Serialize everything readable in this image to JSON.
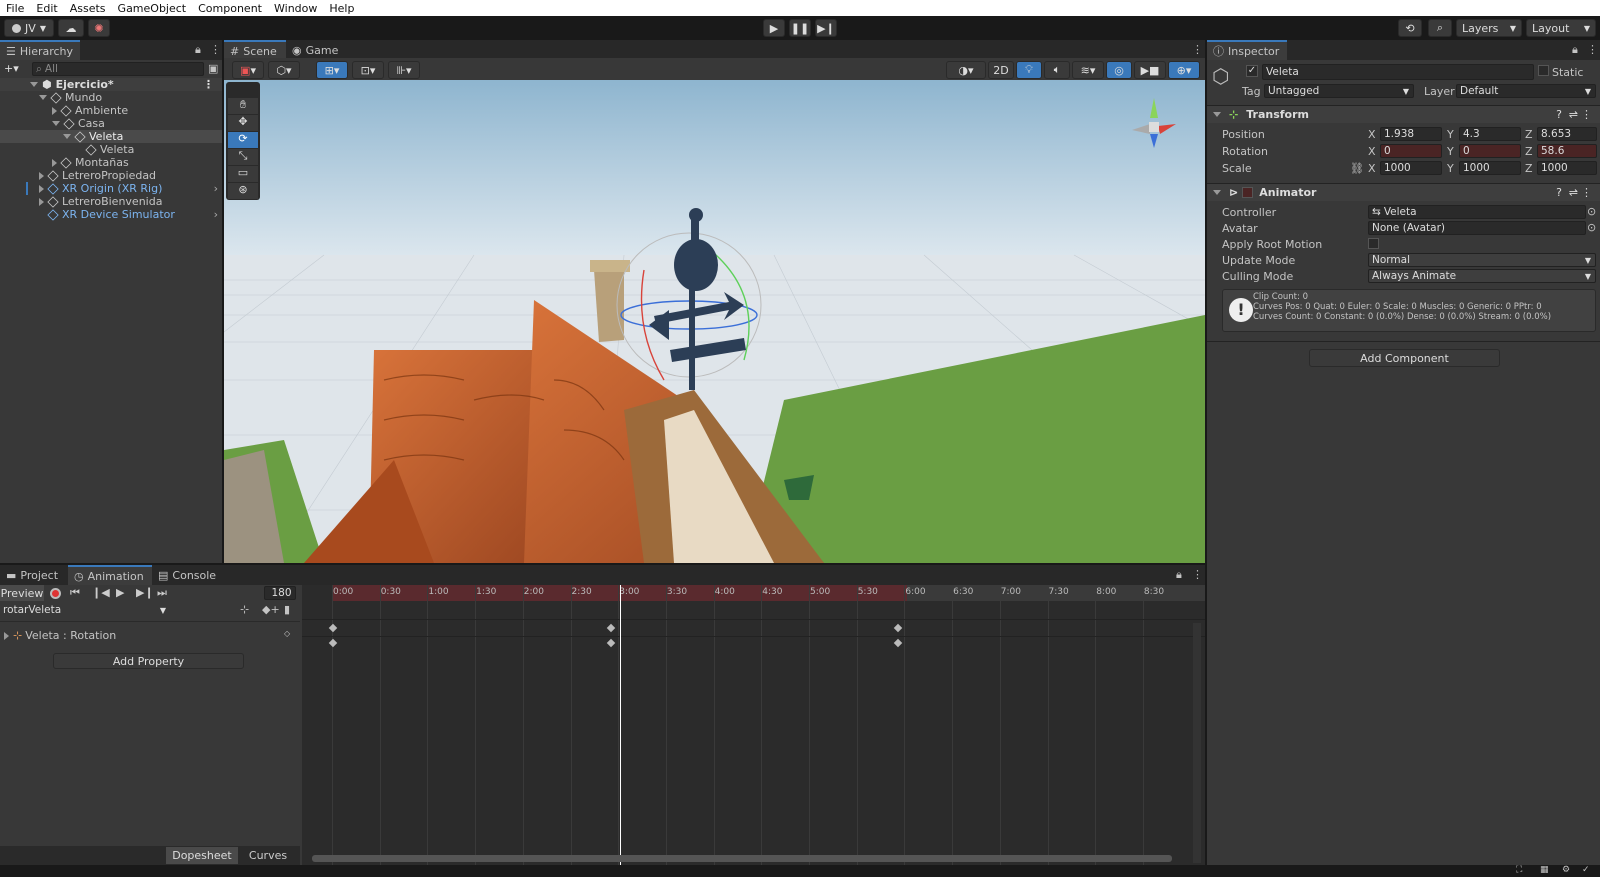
{
  "menu": [
    "File",
    "Edit",
    "Assets",
    "GameObject",
    "Component",
    "Window",
    "Help"
  ],
  "toolbar": {
    "account": "JV",
    "layers": "Layers",
    "layout": "Layout"
  },
  "hierarchy": {
    "tab": "Hierarchy",
    "search_placeholder": "All",
    "items": [
      {
        "label": "Ejercicio*",
        "depth": 0,
        "bold": true
      },
      {
        "label": "Mundo",
        "depth": 1
      },
      {
        "label": "Ambiente",
        "depth": 2
      },
      {
        "label": "Casa",
        "depth": 2
      },
      {
        "label": "Veleta",
        "depth": 3,
        "selected": true
      },
      {
        "label": "Veleta",
        "depth": 4
      },
      {
        "label": "Montañas",
        "depth": 2
      },
      {
        "label": "LetreroPropiedad",
        "depth": 1
      },
      {
        "label": "XR Origin (XR Rig)",
        "depth": 1,
        "blue": true
      },
      {
        "label": "LetreroBienvenida",
        "depth": 1
      },
      {
        "label": "XR Device Simulator",
        "depth": 1,
        "blue": true
      }
    ]
  },
  "scene": {
    "tab_scene": "Scene",
    "tab_game": "Game",
    "btn_2d": "2D"
  },
  "inspector": {
    "tab": "Inspector",
    "object_name": "Veleta",
    "static_label": "Static",
    "tag_label": "Tag",
    "tag_value": "Untagged",
    "layer_label": "Layer",
    "layer_value": "Default",
    "transform": {
      "title": "Transform",
      "position": {
        "label": "Position",
        "x": "1.938",
        "y": "4.3",
        "z": "8.653"
      },
      "rotation": {
        "label": "Rotation",
        "x": "0",
        "y": "0",
        "z": "58.6"
      },
      "scale": {
        "label": "Scale",
        "x": "1000",
        "y": "1000",
        "z": "1000"
      }
    },
    "animator": {
      "title": "Animator",
      "controller_label": "Controller",
      "controller_value": "Veleta",
      "avatar_label": "Avatar",
      "avatar_value": "None (Avatar)",
      "root_motion_label": "Apply Root Motion",
      "update_label": "Update Mode",
      "update_value": "Normal",
      "culling_label": "Culling Mode",
      "culling_value": "Always Animate",
      "info1": "Clip Count: 0",
      "info2": "Curves Pos: 0 Quat: 0 Euler: 0 Scale: 0 Muscles: 0 Generic: 0 PPtr: 0",
      "info3": "Curves Count: 0 Constant: 0 (0.0%) Dense: 0 (0.0%) Stream: 0 (0.0%)"
    },
    "add_component": "Add Component"
  },
  "bottom": {
    "tab_project": "Project",
    "tab_animation": "Animation",
    "tab_console": "Console"
  },
  "animation": {
    "preview": "Preview",
    "frame": "180",
    "clip": "rotarVeleta",
    "property": "Veleta : Rotation",
    "add_property": "Add Property",
    "dopesheet": "Dopesheet",
    "curves": "Curves",
    "ticks": [
      "0:00",
      "0:30",
      "1:00",
      "1:30",
      "2:00",
      "2:30",
      "3:00",
      "3:30",
      "4:00",
      "4:30",
      "5:00",
      "5:30",
      "6:00",
      "6:30",
      "7:00",
      "7:30",
      "8:00",
      "8:30"
    ]
  }
}
